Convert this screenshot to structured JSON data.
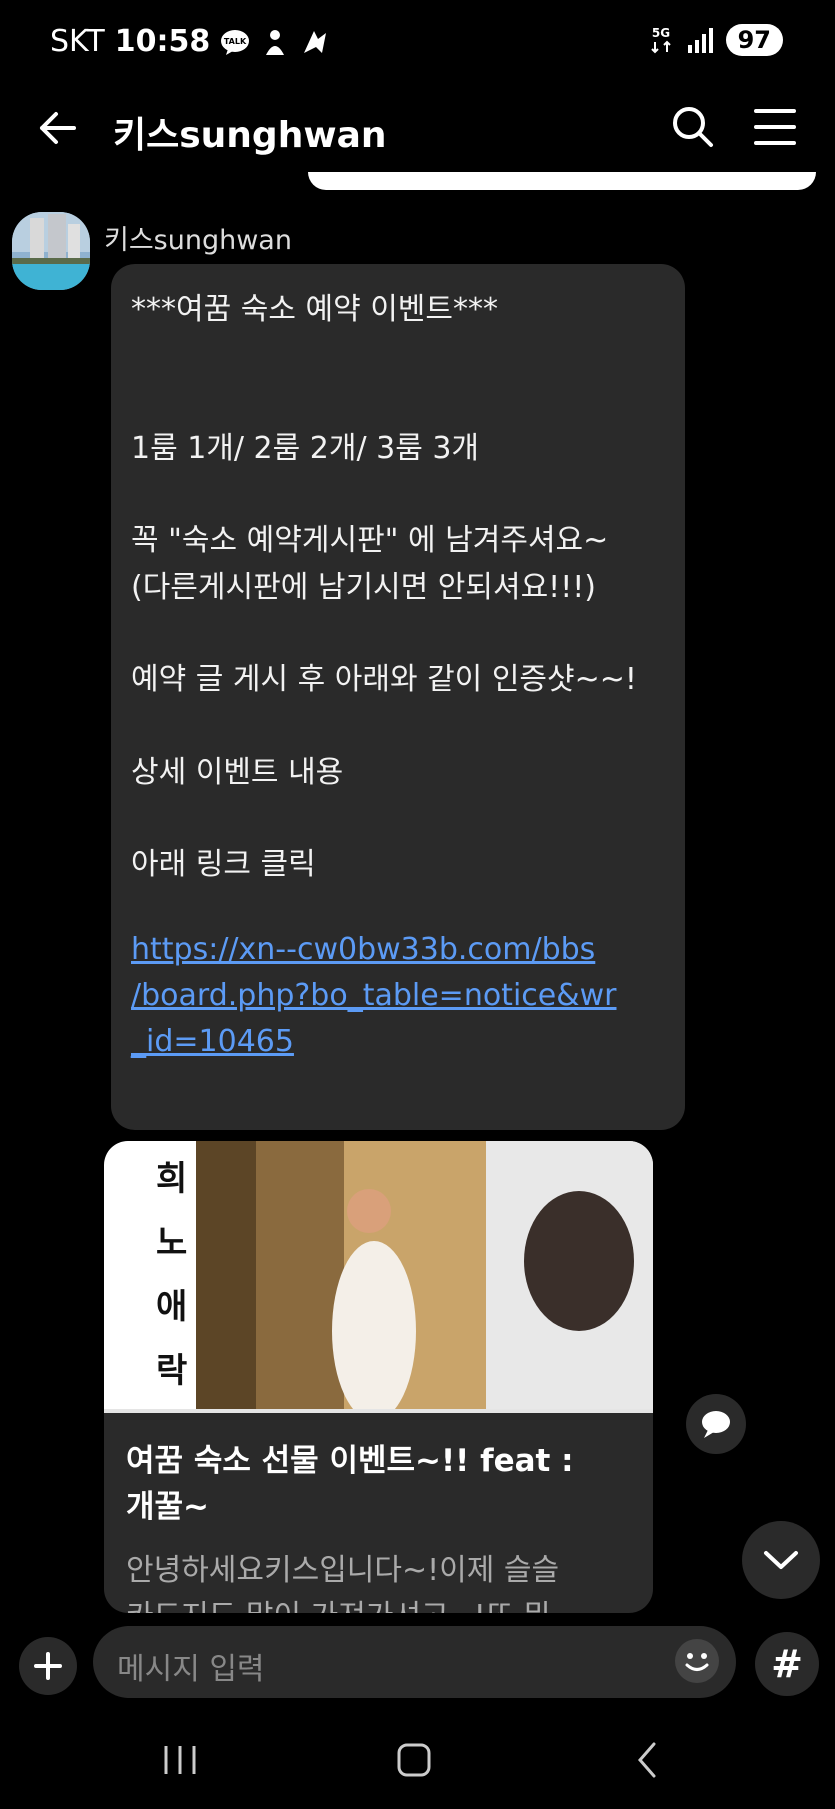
{
  "status_bar": {
    "carrier": "SKT",
    "time": "10:58",
    "network": "5G",
    "battery": "97"
  },
  "header": {
    "title": "키스sunghwan"
  },
  "message": {
    "sender": "키스sunghwan",
    "lines": [
      "***여꿈 숙소 예약 이벤트***",
      "1룸 1개/ 2룸 2개/ 3룸 3개",
      "꼭  \"숙소 예약게시판\" 에 남겨주셔요~",
      "(다른게시판에 남기시면 안되셔요!!!)",
      "예약 글 게시 후 아래와 같이 인증샷~~!",
      "상세 이벤트 내용",
      "아래 링크 클릭"
    ],
    "link_lines": [
      "https://xn--cw0bw33b.com/bbs",
      "/board.php?bo_table=notice&wr",
      "_id=10465"
    ]
  },
  "preview_card": {
    "image_text": [
      "희",
      "노",
      "애",
      "락"
    ],
    "title_lines": [
      "여꿈 숙소 선물 이벤트~!! feat :",
      "개꿀~"
    ],
    "desc_lines": [
      "안녕하세요키스입니다~!이제 슬슬",
      "카드지도 많이 가져가셔고~!또 뭐"
    ]
  },
  "composer": {
    "placeholder": "메시지 입력",
    "hash_label": "#"
  }
}
